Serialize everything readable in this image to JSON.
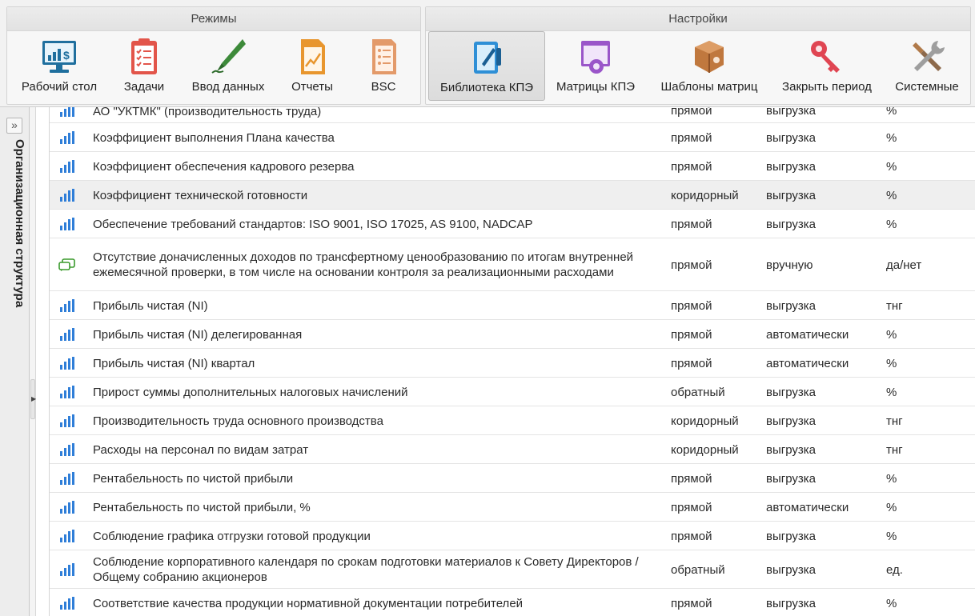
{
  "toolbar": {
    "modes": {
      "title": "Режимы",
      "buttons": [
        {
          "label": "Рабочий стол",
          "icon": "dashboard-monitor-icon"
        },
        {
          "label": "Задачи",
          "icon": "task-checklist-icon"
        },
        {
          "label": "Ввод данных",
          "icon": "pen-input-icon"
        },
        {
          "label": "Отчеты",
          "icon": "report-document-icon"
        },
        {
          "label": "BSC",
          "icon": "bsc-scorecard-icon"
        }
      ]
    },
    "settings": {
      "title": "Настройки",
      "buttons": [
        {
          "label": "Библиотека КПЭ",
          "icon": "library-book-icon",
          "active": true
        },
        {
          "label": "Матрицы КПЭ",
          "icon": "matrix-gear-icon"
        },
        {
          "label": "Шаблоны матриц",
          "icon": "template-box-icon"
        },
        {
          "label": "Закрыть период",
          "icon": "key-icon"
        },
        {
          "label": "Системные",
          "icon": "tools-wrench-icon"
        }
      ]
    }
  },
  "sidepanel": {
    "label": "Организационная структура",
    "expand_label": "»"
  },
  "colors": {
    "bar_icon": "#2f7ed8",
    "chat_icon": "#3a9a2c",
    "selected_row": "#efefef"
  },
  "rows": [
    {
      "icon": "bar-chart-icon",
      "name": "АО \"УКТМК\" (производительность труда)",
      "type": "прямой",
      "source": "выгрузка",
      "unit": "%"
    },
    {
      "icon": "bar-chart-icon",
      "name": "Коэффициент выполнения Плана качества",
      "type": "прямой",
      "source": "выгрузка",
      "unit": "%"
    },
    {
      "icon": "bar-chart-icon",
      "name": "Коэффициент обеспечения кадрового резерва",
      "type": "прямой",
      "source": "выгрузка",
      "unit": "%"
    },
    {
      "icon": "bar-chart-icon",
      "name": "Коэффициент технической готовности",
      "type": "коридорный",
      "source": "выгрузка",
      "unit": "%",
      "selected": true
    },
    {
      "icon": "bar-chart-icon",
      "name": "Обеспечение требований стандартов: ISO 9001, ISO 17025, AS 9100, NADCAP",
      "type": "прямой",
      "source": "выгрузка",
      "unit": "%"
    },
    {
      "icon": "chat-icon",
      "name": "Отсутствие доначисленных доходов по трансфертному ценообразованию по итогам внутренней ежемесячной проверки, в том числе на основании контроля за реализационными расходами",
      "type": "прямой",
      "source": "вручную",
      "unit": "да/нет"
    },
    {
      "icon": "bar-chart-icon",
      "name": "Прибыль чистая (NI)",
      "type": "прямой",
      "source": "выгрузка",
      "unit": "тнг"
    },
    {
      "icon": "bar-chart-icon",
      "name": "Прибыль чистая (NI) делегированная",
      "type": "прямой",
      "source": "автоматически",
      "unit": "%"
    },
    {
      "icon": "bar-chart-icon",
      "name": "Прибыль чистая (NI) квартал",
      "type": "прямой",
      "source": "автоматически",
      "unit": "%"
    },
    {
      "icon": "bar-chart-icon",
      "name": "Прирост суммы дополнительных налоговых начислений",
      "type": "обратный",
      "source": "выгрузка",
      "unit": "%"
    },
    {
      "icon": "bar-chart-icon",
      "name": "Производительность труда основного производства",
      "type": "коридорный",
      "source": "выгрузка",
      "unit": "тнг"
    },
    {
      "icon": "bar-chart-icon",
      "name": "Расходы на персонал по видам затрат",
      "type": "коридорный",
      "source": "выгрузка",
      "unit": "тнг"
    },
    {
      "icon": "bar-chart-icon",
      "name": "Рентабельность по чистой прибыли",
      "type": "прямой",
      "source": "выгрузка",
      "unit": "%"
    },
    {
      "icon": "bar-chart-icon",
      "name": "Рентабельность по чистой прибыли, %",
      "type": "прямой",
      "source": "автоматически",
      "unit": "%"
    },
    {
      "icon": "bar-chart-icon",
      "name": "Соблюдение графика отгрузки готовой продукции",
      "type": "прямой",
      "source": "выгрузка",
      "unit": "%"
    },
    {
      "icon": "bar-chart-icon",
      "name": "Соблюдение корпоративного календаря по срокам подготовки материалов к Совету Директоров / Общему собранию акционеров",
      "type": "обратный",
      "source": "выгрузка",
      "unit": "ед."
    },
    {
      "icon": "bar-chart-icon",
      "name": "Соответствие качества продукции нормативной документации потребителей",
      "type": "прямой",
      "source": "выгрузка",
      "unit": "%"
    }
  ]
}
